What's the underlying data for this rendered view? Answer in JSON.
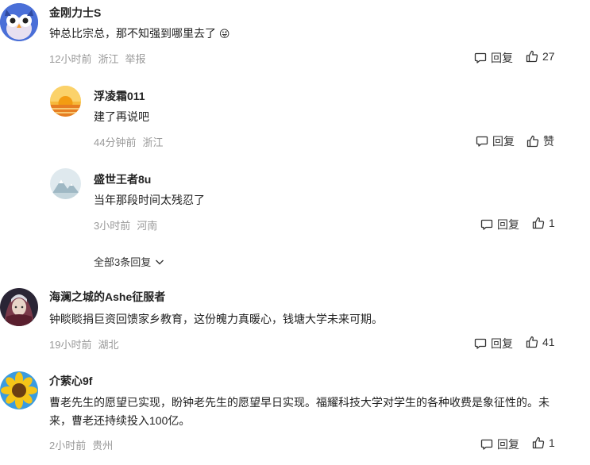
{
  "comments": [
    {
      "name": "金刚力士S",
      "text": "钟总比宗总，那不知强到哪里去了",
      "emoji": "😜",
      "time": "12小时前",
      "location": "浙江",
      "report": "举报",
      "reply_label": "回复",
      "like_count": "27",
      "replies": [
        {
          "name": "浮凌霜011",
          "text": "建了再说吧",
          "time": "44分钟前",
          "location": "浙江",
          "reply_label": "回复",
          "like_label": "赞"
        },
        {
          "name": "盛世王者8u",
          "text": "当年那段时间太残忍了",
          "time": "3小时前",
          "location": "河南",
          "reply_label": "回复",
          "like_count": "1"
        }
      ],
      "expand_label": "全部3条回复"
    },
    {
      "name": "海澜之城的Ashe征服者",
      "text": "钟睒睒捐巨资回馈家乡教育，这份魄力真暖心，钱塘大学未来可期。",
      "time": "19小时前",
      "location": "湖北",
      "reply_label": "回复",
      "like_count": "41"
    },
    {
      "name": "介萦心9f",
      "text": "曹老先生的愿望已实现，盼钟老先生的愿望早日实现。福耀科技大学对学生的各种收费是象征性的。未来，曹老还持续投入100亿。",
      "time": "2小时前",
      "location": "贵州",
      "reply_label": "回复",
      "like_count": "1"
    }
  ]
}
